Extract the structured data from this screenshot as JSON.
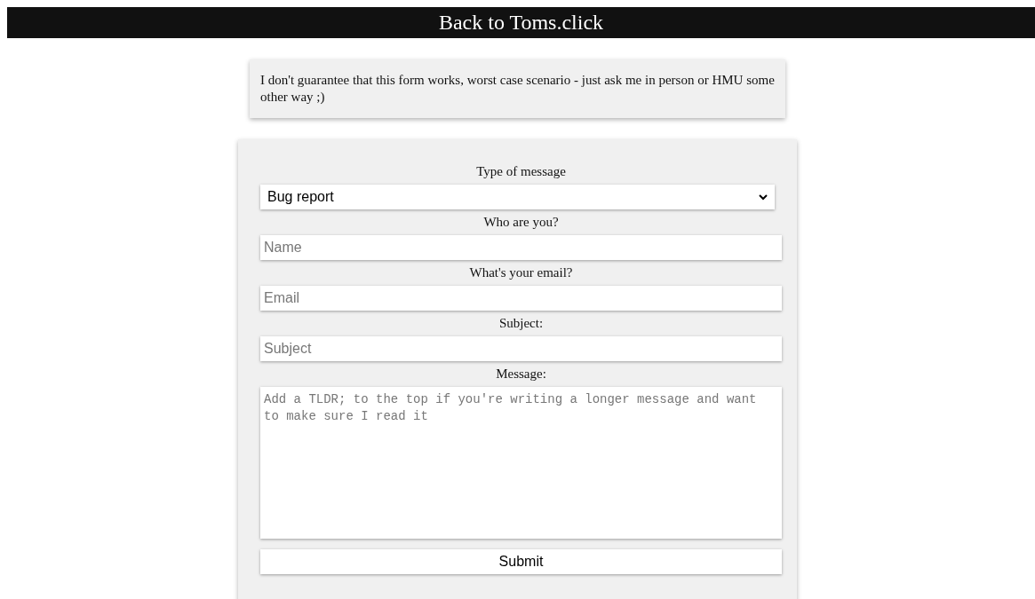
{
  "nav_link": "Back to Toms.click",
  "notice": "I don't guarantee that this form works, worst case scenario - just ask me in person or HMU some other way ;)",
  "form": {
    "fields": [
      {
        "kind": "select",
        "label": "Type of message",
        "value": "Bug report"
      },
      {
        "kind": "input",
        "label": "Who are you?",
        "placeholder": "Name"
      },
      {
        "kind": "input",
        "label": "What's your email?",
        "placeholder": "Email"
      },
      {
        "kind": "input",
        "label": "Subject:",
        "placeholder": "Subject"
      },
      {
        "kind": "textarea",
        "label": "Message:",
        "placeholder": "Add a TLDR; to the top if you're writing a longer message and want to make sure I read it"
      }
    ],
    "submit": "Submit"
  }
}
